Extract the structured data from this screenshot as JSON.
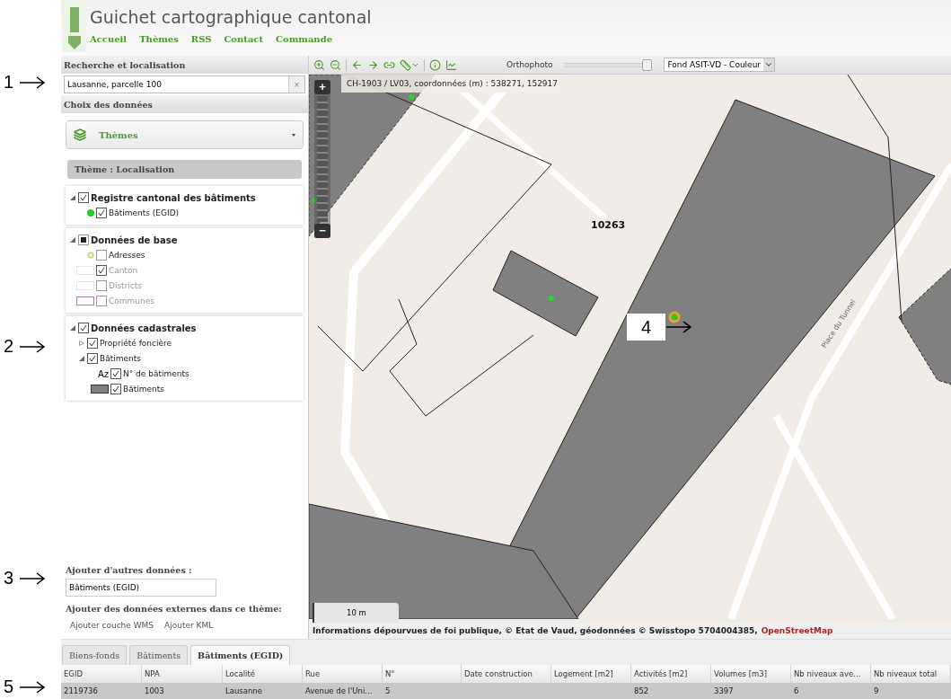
{
  "header": {
    "title": "Guichet cartographique cantonal",
    "nav": [
      "Accueil",
      "Thèmes",
      "RSS",
      "Contact",
      "Commande"
    ]
  },
  "search": {
    "heading": "Recherche et localisation",
    "value": "Lausanne, parcelle 100",
    "clear": "×"
  },
  "data_choice": {
    "heading": "Choix des données",
    "dropdown": "Thèmes",
    "theme_title": "Thème : Localisation"
  },
  "layer_groups": [
    {
      "label": "Registre cantonal des bâtiments",
      "checked": true,
      "indeterminate": false,
      "expanded": true,
      "children": [
        {
          "label": "Bâtiments (EGID)",
          "checked": true,
          "disabled": false,
          "legend": {
            "kind": "dot",
            "color": "#22cc22"
          }
        }
      ]
    },
    {
      "label": "Données de base",
      "checked": false,
      "indeterminate": true,
      "expanded": true,
      "children": [
        {
          "label": "Adresses",
          "checked": false,
          "disabled": false,
          "legend": {
            "kind": "ring",
            "color": "#c8d06a"
          }
        },
        {
          "label": "Canton",
          "checked": true,
          "disabled": true,
          "legend": {
            "kind": "box",
            "color": "#e4e4e4"
          }
        },
        {
          "label": "Districts",
          "checked": false,
          "disabled": true,
          "legend": {
            "kind": "box",
            "color": "#e4e4e4"
          }
        },
        {
          "label": "Communes",
          "checked": false,
          "disabled": true,
          "legend": {
            "kind": "box",
            "color": "#b07ab0"
          }
        }
      ]
    },
    {
      "label": "Données cadastrales",
      "checked": true,
      "indeterminate": false,
      "expanded": true,
      "children": [
        {
          "label": "Propriété foncière",
          "checked": true,
          "disabled": false,
          "expanded": false
        },
        {
          "label": "Bâtiments",
          "checked": true,
          "disabled": false,
          "expanded": true,
          "children": [
            {
              "label": "N° de bâtiments",
              "checked": true,
              "disabled": false,
              "legend": {
                "kind": "text",
                "text": "Az"
              }
            },
            {
              "label": "Bâtiments",
              "checked": true,
              "disabled": false,
              "legend": {
                "kind": "fill",
                "color": "#808080"
              }
            }
          ]
        }
      ]
    }
  ],
  "add_data": {
    "heading": "Ajouter d'autres données :",
    "value": "Bâtiments (EGID)",
    "external_heading": "Ajouter des données externes dans ce thème:",
    "links": [
      "Ajouter couche WMS",
      "Ajouter KML"
    ]
  },
  "map": {
    "background_label": "Orthophoto",
    "opacity": {
      "level": 0.97
    },
    "basemap": "Fond ASIT-VD - Couleur",
    "coordinates": "CH-1903 / LV03, coordonnées (m) : 538271, 152917",
    "zoom_in": "+",
    "zoom_out": "−",
    "scale": "10 m",
    "parcel_label": "10263",
    "street_label": "Place du Tunnel",
    "attribution": "Informations dépourvues de foi publique, © Etat de Vaud, géodonnées © Swisstopo 5704004385,",
    "attribution_link": "OpenStreetMap"
  },
  "result_tabs": [
    {
      "label": "Biens-fonds",
      "selected": false
    },
    {
      "label": "Bâtiments",
      "selected": false
    },
    {
      "label": "Bâtiments (EGID)",
      "selected": true
    }
  ],
  "table": {
    "columns": [
      "EGID",
      "NPA",
      "Localité",
      "Rue",
      "N°",
      "Date construction",
      "Logement [m2]",
      "Activités [m2]",
      "Volumes [m3]",
      "Nb niveaux ave...",
      "Nb niveaux total"
    ],
    "rows": [
      {
        "selected": true,
        "cells": [
          "2119736",
          "1003",
          "Lausanne",
          "Avenue de l'Uni...",
          "5",
          "",
          "",
          "852",
          "3397",
          "6",
          "9"
        ]
      }
    ]
  },
  "callouts": [
    "1",
    "2",
    "3",
    "4",
    "5"
  ]
}
